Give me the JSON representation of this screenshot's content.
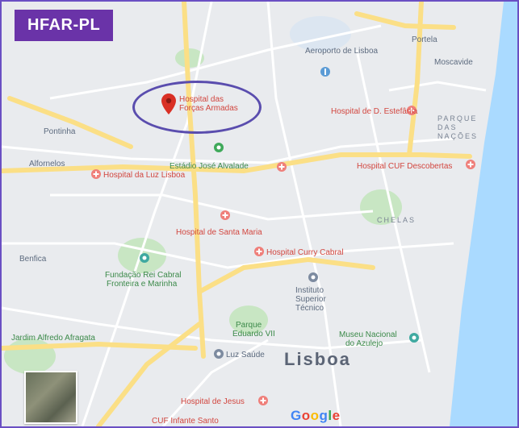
{
  "badge": "HFAR-PL",
  "city": "Lisboa",
  "google_logo": [
    "G",
    "o",
    "o",
    "g",
    "l",
    "e"
  ],
  "selected_place": {
    "name_line1": "Hospital das",
    "name_line2": "Forças Armadas"
  },
  "hospitals": {
    "cuf_descobertas": "Hospital CUF Descobertas",
    "santa_maria": "Hospital de Santa Maria",
    "curry_cabral": "Hospital Curry Cabral",
    "dona_estefania": "Hospital de D. Estefânia",
    "jesus": "Hospital de Jesus",
    "luz": "Hospital da Luz Lisboa",
    "cuf_infante": "CUF Infante Santo"
  },
  "places": {
    "aeroporto": "Aeroporto de Lisboa",
    "portela": "Portela",
    "moscavide": "Moscavide",
    "pontinha": "Pontinha",
    "alfornelos": "Alfornelos",
    "benfica": "Benfica",
    "estadio": "Estádio José Alvalade",
    "olivais": "PARQUE DAS NAÇÕES",
    "chelas": "CHELAS",
    "fundacao_line1": "Fundação Rei Cabral",
    "fundacao_line2": "Fronteira e Marinha",
    "instituto_line1": "Instituto",
    "instituto_line2": "Superior",
    "instituto_line3": "Técnico",
    "parque_line1": "Parque",
    "parque_line2": "Eduardo VII",
    "luz_saude": "Luz Saúde",
    "museu_line1": "Museu Nacional",
    "museu_line2": "do Azulejo",
    "jardim": "Jardim Alfredo Afragata"
  },
  "colors": {
    "frame": "#6a4fc3",
    "badge": "#6a33a8",
    "water": "#aadaff",
    "land": "#e9ebee",
    "park": "#c8e6c3",
    "road_major": "#fbdf86",
    "road_minor": "#ffffff",
    "marker": "#d93025"
  }
}
